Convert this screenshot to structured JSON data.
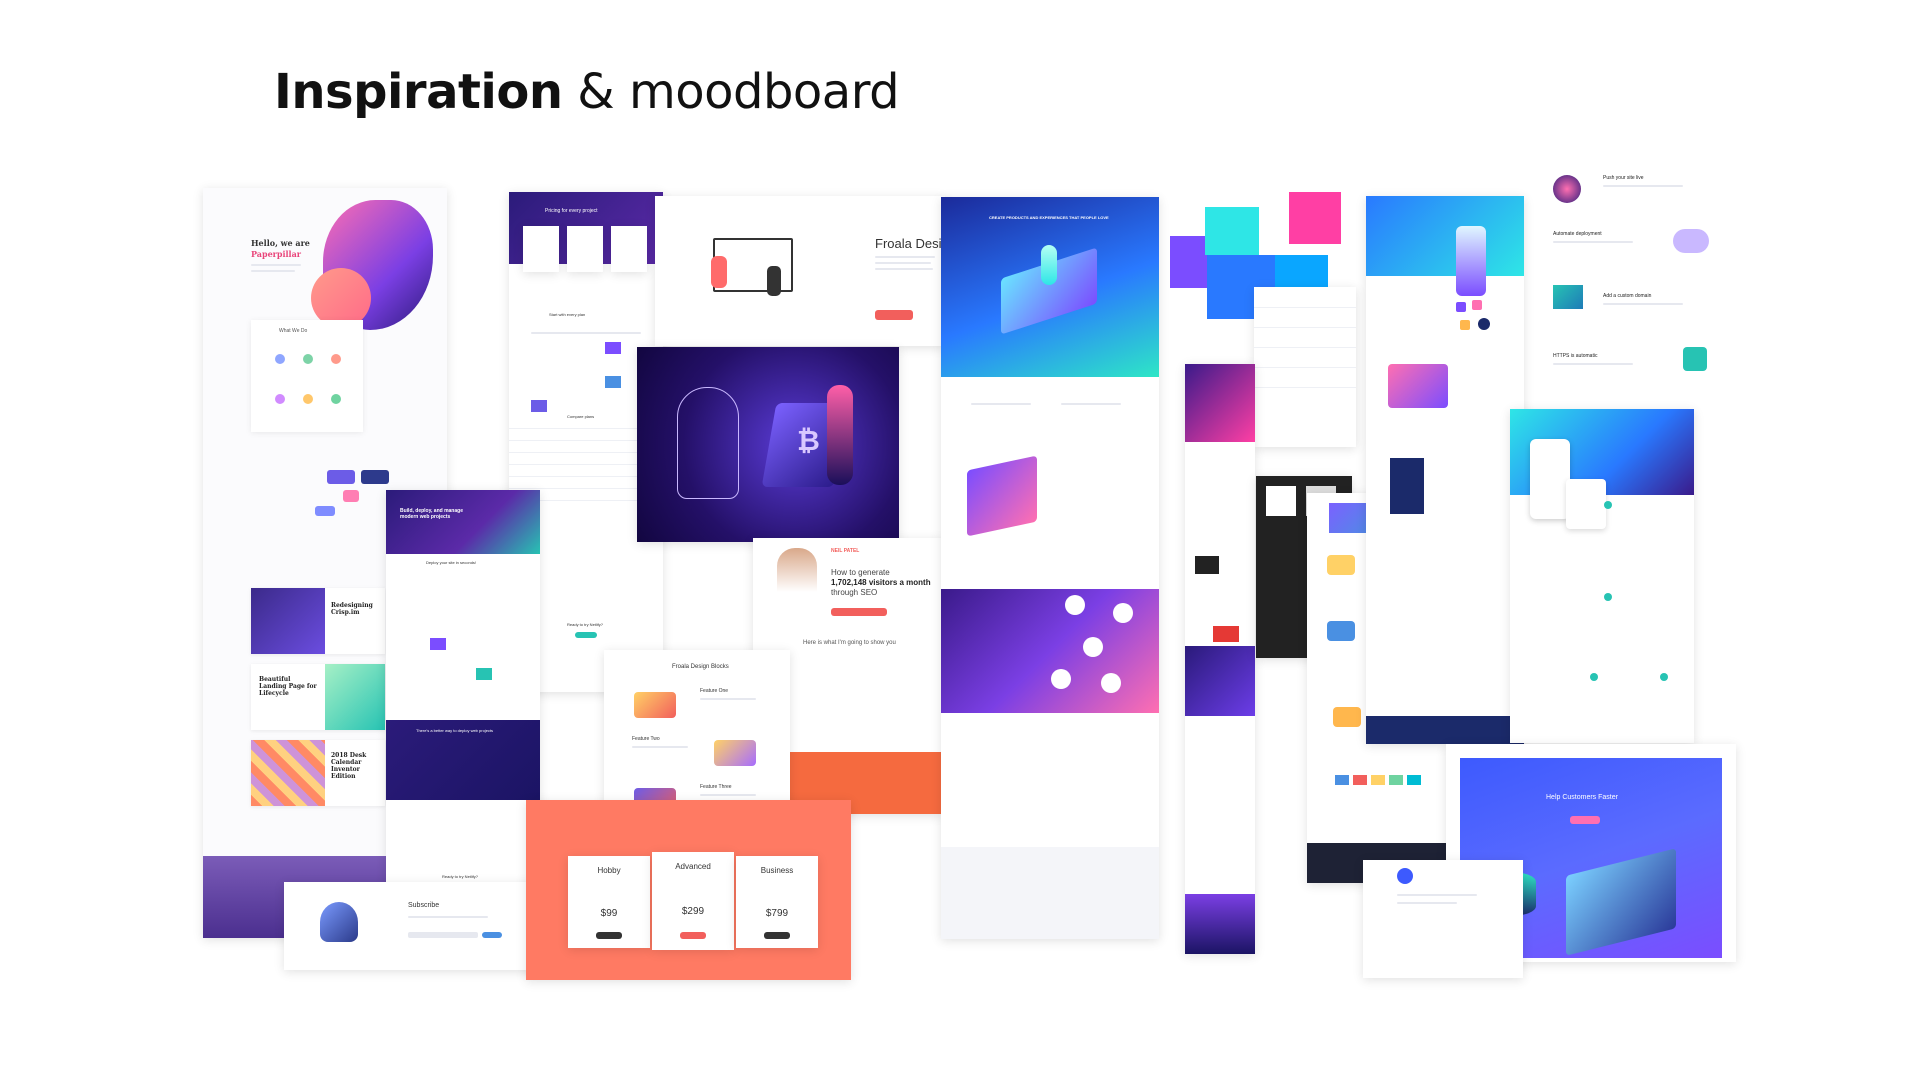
{
  "header": {
    "title_bold": "Inspiration",
    "title_rest": " & moodboard"
  },
  "papercard": {
    "hello": "Hello, we are",
    "brand": "Paperpillar",
    "what_we_do": "What We Do",
    "project1": "Redesigning Crisp.im",
    "project2": "Beautiful Landing Page for Lifecycle",
    "project3": "2018 Desk Calendar Inventor Edition"
  },
  "netlify_pricing": {
    "heading": "Pricing for every project",
    "team": "Start with every plan",
    "compare": "Compare plans",
    "faq": "Ready to try Netlify?"
  },
  "netlify_deploy": {
    "heading": "Build, deploy, and manage modern web projects",
    "fastest": "Deploy your site in seconds!",
    "pricing_band": "There's a better way to deploy web projects",
    "ready": "Ready to try Netlify?"
  },
  "subscribe": {
    "heading": "Subscribe"
  },
  "froala": {
    "heading": "Froala Design",
    "blocks_title": "Froala Design Blocks",
    "feature_one": "Feature One",
    "feature_two": "Feature Two",
    "feature_three": "Feature Three"
  },
  "pricing_table": {
    "plans": [
      {
        "name": "Hobby",
        "price": "$99"
      },
      {
        "name": "Advanced",
        "price": "$299"
      },
      {
        "name": "Business",
        "price": "$799"
      }
    ]
  },
  "seo": {
    "name": "NEIL PATEL",
    "line1": "How to generate",
    "line2": "1,702,148 visitors a month",
    "line3": "through SEO",
    "section": "Here is what I'm going to show you"
  },
  "teal_card": {
    "heading": "CREATE PRODUCTS AND EXPERIENCES THAT PEOPLE LOVE"
  },
  "help_card": {
    "heading": "Help Customers Faster"
  },
  "deploy_steps": {
    "step1": "Push your site live",
    "step2": "Automate deployment",
    "step3": "Add a custom domain",
    "step4": "HTTPS is automatic"
  },
  "colors": {
    "purple": "#6c3de8",
    "navy": "#1b1464",
    "coral": "#ff7a63",
    "teal": "#27c3b3",
    "pink": "#ff3fa4",
    "cyan": "#2ee6e6",
    "blue": "#2979ff",
    "violet": "#7b4dff"
  }
}
